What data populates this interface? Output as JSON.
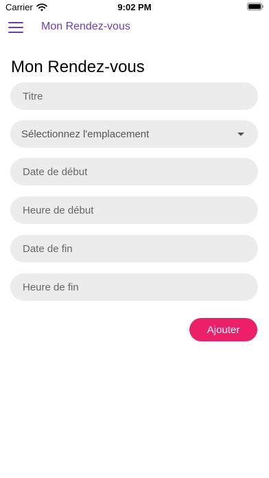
{
  "status_bar": {
    "carrier": "Carrier",
    "time": "9:02 PM"
  },
  "nav": {
    "title": "Mon Rendez-vous",
    "menu_icon": "menu-icon"
  },
  "page": {
    "title": "Mon Rendez-vous"
  },
  "form": {
    "title_placeholder": "Titre",
    "location_select": "Sélectionnez l'emplacement",
    "start_date_placeholder": "Date de début",
    "start_time_placeholder": "Heure de début",
    "end_date_placeholder": "Date de fin",
    "end_time_placeholder": "Heure de fin",
    "submit_label": "Ajouter"
  },
  "colors": {
    "accent": "#6a3db6",
    "button": "#eb2066",
    "field_background": "#ececec"
  }
}
